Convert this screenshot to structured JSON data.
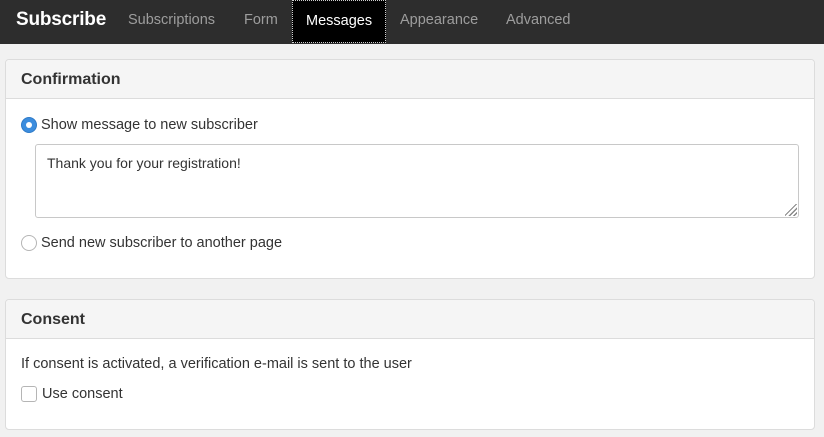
{
  "navbar": {
    "brand": "Subscribe",
    "tabs": [
      {
        "label": "Subscriptions",
        "active": false
      },
      {
        "label": "Form",
        "active": false
      },
      {
        "label": "Messages",
        "active": true
      },
      {
        "label": "Appearance",
        "active": false
      },
      {
        "label": "Advanced",
        "active": false
      }
    ]
  },
  "confirmation": {
    "title": "Confirmation",
    "option_show_label": "Show message to new subscriber",
    "option_show_selected": true,
    "message_value": "Thank you for your registration!",
    "option_redirect_label": "Send new subscriber to another page",
    "option_redirect_selected": false
  },
  "consent": {
    "title": "Consent",
    "help_text": "If consent is activated, a verification e-mail is sent to the user",
    "checkbox_label": "Use consent",
    "checkbox_checked": false
  },
  "colors": {
    "navbar_bg": "#2d2d2d",
    "active_tab_bg": "#000000",
    "radio_accent": "#3c8dde",
    "page_bg": "#f1f1f1"
  }
}
